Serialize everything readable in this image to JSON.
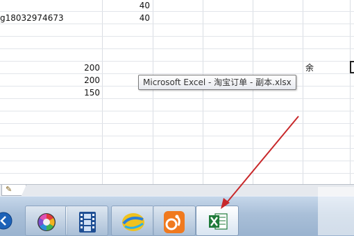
{
  "sheet": {
    "rows": [
      {
        "a": "",
        "c": "40"
      },
      {
        "a": "g18032974673",
        "c": "40"
      },
      {
        "b": "200",
        "g": "余"
      },
      {
        "b": "200"
      },
      {
        "b": "150"
      }
    ]
  },
  "tooltip": {
    "text": "Microsoft Excel - 淘宝订单 - 副本.xlsx"
  },
  "colors": {
    "arrow": "#c8282a",
    "excel_green": "#1f7a3a",
    "taskbar": "#a9bfd8"
  },
  "taskbar": {
    "items": [
      {
        "icon": "back-circle-icon"
      },
      {
        "icon": "color-wheel-icon"
      },
      {
        "icon": "film-strip-icon"
      },
      {
        "icon": "swirl-app-icon"
      },
      {
        "icon": "uc-browser-icon"
      },
      {
        "icon": "excel-icon",
        "active": true
      }
    ]
  }
}
